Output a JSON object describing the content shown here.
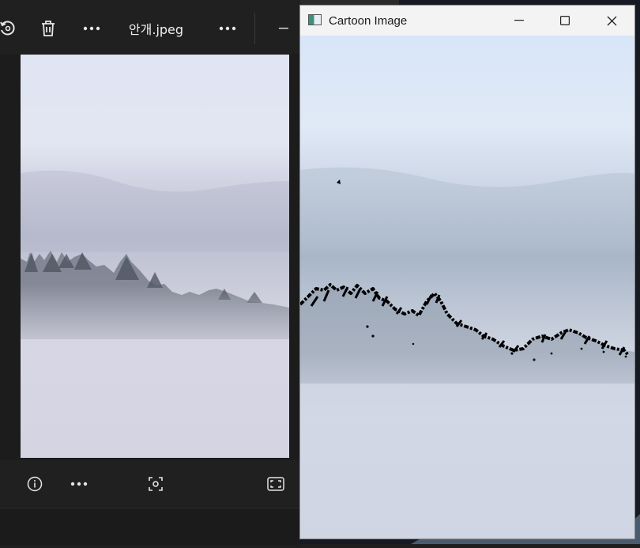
{
  "viewer": {
    "filename": "안개.jpeg",
    "toolbar_icons": [
      "rotate-icon",
      "delete-icon",
      "more-icon",
      "more-icon",
      "minimize-icon"
    ],
    "bottom_icons": [
      "info-icon",
      "more-icon",
      "visual-search-icon",
      "fullscreen-icon"
    ]
  },
  "window": {
    "title": "Cartoon Image",
    "controls": [
      "minimize-icon",
      "maximize-icon",
      "close-icon"
    ]
  },
  "colors": {
    "viewer_bg": "#1c1c1c",
    "toolbar_bg": "#202020",
    "titlebar_bg": "#f3f3f3",
    "sky_top": "#dfe6f4",
    "fog": "#cfd4e2",
    "tree_edge": "#000000"
  }
}
